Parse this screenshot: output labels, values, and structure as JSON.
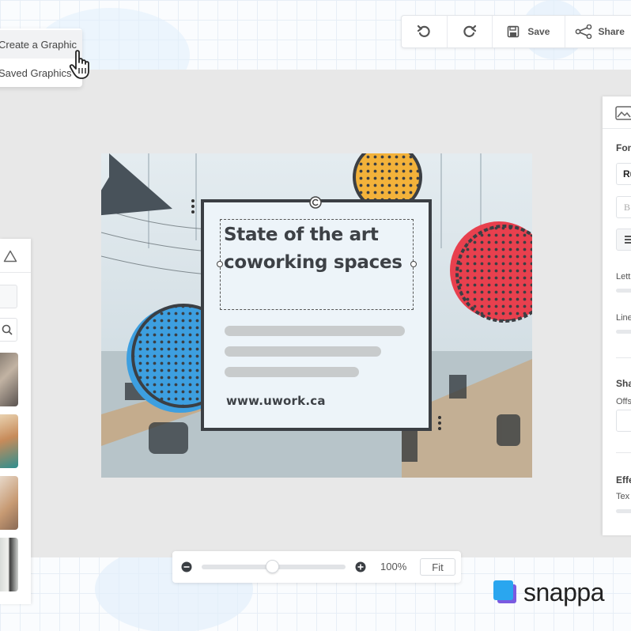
{
  "menu": {
    "items": [
      {
        "label": "Create a Graphic",
        "highlighted": true
      },
      {
        "label": "Saved Graphics",
        "highlighted": false
      }
    ]
  },
  "toolbar": {
    "undo_icon": "undo-icon",
    "redo_icon": "redo-icon",
    "save_label": "Save",
    "share_label": "Share"
  },
  "right_panel": {
    "icon": "image-icon",
    "section_font": "Fon",
    "font_value": "Ru",
    "font_style_value": "B",
    "align_icon": "align-icon",
    "letter_label": "Lett",
    "line_label": "Line",
    "section_shadow": "Sha",
    "offset_label": "Offs",
    "section_effects": "Effe",
    "text_label": "Tex"
  },
  "left_panel": {
    "icon": "shapes-icon",
    "search_icon": "search-icon"
  },
  "design": {
    "headline": "State of the art coworking spaces",
    "url": "www.uwork.ca",
    "colors": {
      "yellow": "#f3b23a",
      "red": "#e8404e",
      "blue": "#3d9fe0",
      "card": "#edf4f9",
      "border": "#3b3f44"
    }
  },
  "zoom": {
    "level_label": "100%",
    "level": 0.49,
    "fit_label": "Fit",
    "zoom_out_icon": "zoom-out-icon",
    "zoom_in_icon": "zoom-in-icon"
  },
  "brand": {
    "name": "snappa",
    "accent": "#2aa6ef"
  }
}
